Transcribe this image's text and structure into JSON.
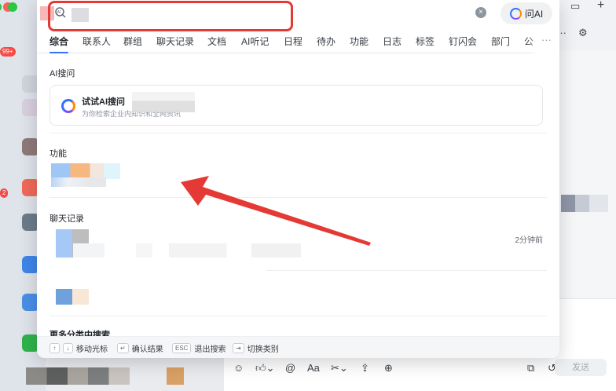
{
  "search": {
    "value": "",
    "placeholder": "",
    "ai_tag": "AI",
    "clear_glyph": "×"
  },
  "ask_ai": {
    "label": "问AI",
    "icon": "ai-logo-icon"
  },
  "tabs": [
    {
      "label": "综合",
      "active": true
    },
    {
      "label": "联系人"
    },
    {
      "label": "群组"
    },
    {
      "label": "聊天记录"
    },
    {
      "label": "文档"
    },
    {
      "label": "AI听记"
    },
    {
      "label": "日程"
    },
    {
      "label": "待办"
    },
    {
      "label": "功能"
    },
    {
      "label": "日志"
    },
    {
      "label": "标签"
    },
    {
      "label": "钉闪会"
    },
    {
      "label": "部门"
    },
    {
      "label": "公"
    }
  ],
  "tabs_more": "···",
  "sections": {
    "ai_search": {
      "title": "AI搜问",
      "card_title": "试试AI搜问",
      "card_subtitle": "为你检索企业内知识和全网资讯"
    },
    "features": {
      "title": "功能"
    },
    "chat_records": {
      "title": "聊天记录",
      "time": "2分钟前"
    },
    "more_categories": {
      "title": "更多分类中搜索"
    }
  },
  "footer": {
    "hints": [
      {
        "keys": [
          "↑",
          "↓"
        ],
        "label": "移动光标"
      },
      {
        "keys": [
          "↵"
        ],
        "label": "确认结果"
      },
      {
        "keys": [
          "ESC"
        ],
        "label": "退出搜索"
      },
      {
        "keys": [
          "⇥"
        ],
        "label": "切换类别"
      }
    ]
  },
  "background": {
    "badges": [
      "99+",
      "2"
    ],
    "compose": {
      "send_label": "发送",
      "font_tool": "Aa"
    }
  },
  "colors": {
    "accent": "#3370ff",
    "annotation": "#e53935",
    "badge": "#f54a45"
  }
}
